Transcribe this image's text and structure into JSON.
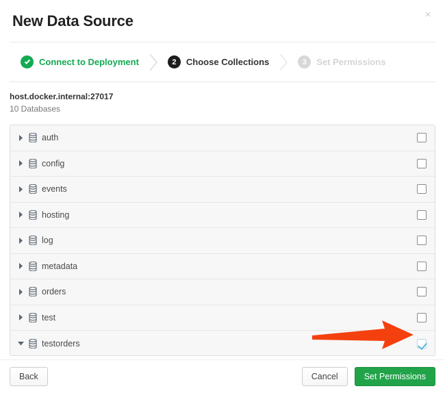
{
  "modal": {
    "title": "New Data Source",
    "close_icon": "close-icon",
    "close_label": "×"
  },
  "stepper": {
    "separator_icon": "chevron-right-icon",
    "steps": [
      {
        "badge": "✓",
        "label": "Connect to Deployment",
        "state": "done",
        "icon": "check-circle-icon"
      },
      {
        "badge": "2",
        "label": "Choose Collections",
        "state": "current",
        "icon": "step-number-icon"
      },
      {
        "badge": "3",
        "label": "Set Permissions",
        "state": "upcoming",
        "icon": "step-number-icon"
      }
    ]
  },
  "deployment": {
    "host": "host.docker.internal:27017",
    "database_count": "10 Databases"
  },
  "database_list": {
    "expand_icon_collapsed": "caret-right-icon",
    "expand_icon_expanded": "caret-down-icon",
    "database_icon": "database-icon",
    "checkbox_icon": "checkbox-icon",
    "rows": [
      {
        "name": "auth",
        "expanded": false,
        "checked": false
      },
      {
        "name": "config",
        "expanded": false,
        "checked": false
      },
      {
        "name": "events",
        "expanded": false,
        "checked": false
      },
      {
        "name": "hosting",
        "expanded": false,
        "checked": false
      },
      {
        "name": "log",
        "expanded": false,
        "checked": false
      },
      {
        "name": "metadata",
        "expanded": false,
        "checked": false
      },
      {
        "name": "orders",
        "expanded": false,
        "checked": false
      },
      {
        "name": "test",
        "expanded": false,
        "checked": false
      },
      {
        "name": "testorders",
        "expanded": true,
        "checked": true
      }
    ]
  },
  "annotation": {
    "icon": "arrow-right-annotation-icon",
    "color": "#F4400F",
    "points_to": "testorders-checkbox"
  },
  "footer": {
    "back_label": "Back",
    "cancel_label": "Cancel",
    "submit_label": "Set Permissions"
  },
  "colors": {
    "accent_green": "#13aa52",
    "primary_button": "#21a34a",
    "checkbox_check": "#5ab4e0",
    "annotation_arrow": "#F4400F"
  }
}
